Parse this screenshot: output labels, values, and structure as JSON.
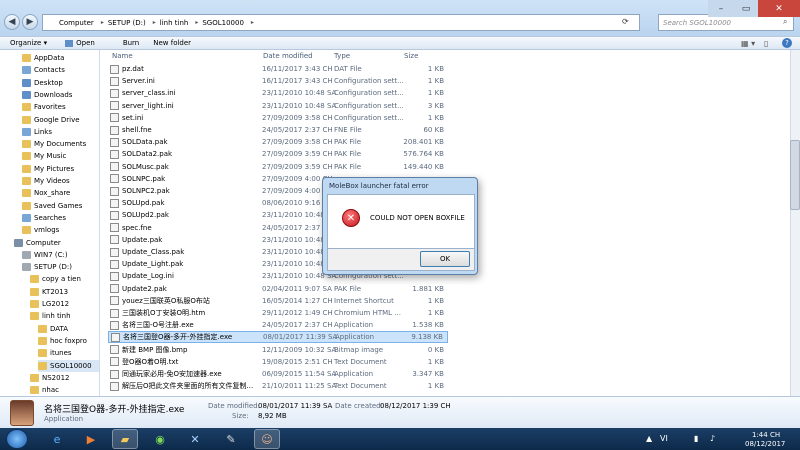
{
  "address": {
    "crumbs": [
      "Computer",
      "SETUP (D:)",
      "linh tinh",
      "SGOL10000"
    ],
    "search_placeholder": "Search SGOL10000"
  },
  "toolbar": {
    "organize": "Organize ▾",
    "open": "Open",
    "burn": "Burn",
    "new_folder": "New folder"
  },
  "nav": [
    {
      "label": "AppData",
      "color": "#e8c15a"
    },
    {
      "label": "Contacts",
      "color": "#7aa6d6"
    },
    {
      "label": "Desktop",
      "color": "#5f8fc9"
    },
    {
      "label": "Downloads",
      "color": "#5f8fc9"
    },
    {
      "label": "Favorites",
      "color": "#e8c15a"
    },
    {
      "label": "Google Drive",
      "color": "#e8c15a"
    },
    {
      "label": "Links",
      "color": "#7aa6d6"
    },
    {
      "label": "My Documents",
      "color": "#e8c15a"
    },
    {
      "label": "My Music",
      "color": "#e8c15a"
    },
    {
      "label": "My Pictures",
      "color": "#e8c15a"
    },
    {
      "label": "My Videos",
      "color": "#e8c15a"
    },
    {
      "label": "Nox_share",
      "color": "#e8c15a"
    },
    {
      "label": "Saved Games",
      "color": "#e8c15a"
    },
    {
      "label": "Searches",
      "color": "#7aa6d6"
    },
    {
      "label": "vmlogs",
      "color": "#e8c15a"
    },
    {
      "label": "Computer",
      "color": "#7a8ea8"
    },
    {
      "label": "WIN7 (C:)",
      "color": "#a0a8b2"
    },
    {
      "label": "SETUP (D:)",
      "color": "#a0a8b2"
    },
    {
      "label": "copy a tien",
      "color": "#e8c15a"
    },
    {
      "label": "KT2013",
      "color": "#e8c15a"
    },
    {
      "label": "LG2012",
      "color": "#e8c15a"
    },
    {
      "label": "linh tinh",
      "color": "#e8c15a"
    },
    {
      "label": "DATA",
      "color": "#e8c15a"
    },
    {
      "label": "hoc foxpro",
      "color": "#e8c15a"
    },
    {
      "label": "itunes",
      "color": "#e8c15a"
    },
    {
      "label": "SGOL10000",
      "color": "#e8c15a"
    },
    {
      "label": "NS2012",
      "color": "#e8c15a"
    },
    {
      "label": "nhac",
      "color": "#e8c15a"
    }
  ],
  "columns": {
    "name": "Name",
    "date": "Date modified",
    "type": "Type",
    "size": "Size"
  },
  "files": [
    {
      "name": "pz.dat",
      "date": "16/11/2017 3:43 CH",
      "type": "DAT File",
      "size": "1 KB"
    },
    {
      "name": "Server.ini",
      "date": "16/11/2017 3:43 CH",
      "type": "Configuration sett...",
      "size": "1 KB"
    },
    {
      "name": "server_class.ini",
      "date": "23/11/2010 10:48 SA",
      "type": "Configuration sett...",
      "size": "1 KB"
    },
    {
      "name": "server_light.ini",
      "date": "23/11/2010 10:48 SA",
      "type": "Configuration sett...",
      "size": "3 KB"
    },
    {
      "name": "set.ini",
      "date": "27/09/2009 3:58 CH",
      "type": "Configuration sett...",
      "size": "1 KB"
    },
    {
      "name": "shell.fne",
      "date": "24/05/2017 2:37 CH",
      "type": "FNE File",
      "size": "60 KB"
    },
    {
      "name": "SOLData.pak",
      "date": "27/09/2009 3:58 CH",
      "type": "PAK File",
      "size": "208.401 KB"
    },
    {
      "name": "SOLData2.pak",
      "date": "27/09/2009 3:59 CH",
      "type": "PAK File",
      "size": "576.764 KB"
    },
    {
      "name": "SOLMusc.pak",
      "date": "27/09/2009 3:59 CH",
      "type": "PAK File",
      "size": "149.440 KB"
    },
    {
      "name": "SOLNPC.pak",
      "date": "27/09/2009 4:00 CH",
      "type": "",
      "size": ""
    },
    {
      "name": "SOLNPC2.pak",
      "date": "27/09/2009 4:00 CH",
      "type": "",
      "size": ""
    },
    {
      "name": "SOLUpd.pak",
      "date": "08/06/2010 9:16 SA",
      "type": "",
      "size": ""
    },
    {
      "name": "SOLUpd2.pak",
      "date": "23/11/2010 10:48 SA",
      "type": "",
      "size": ""
    },
    {
      "name": "spec.fne",
      "date": "24/05/2017 2:37 CH",
      "type": "",
      "size": ""
    },
    {
      "name": "Update.pak",
      "date": "23/11/2010 10:48 SA",
      "type": "",
      "size": ""
    },
    {
      "name": "Update_Class.pak",
      "date": "23/11/2010 10:48 SA",
      "type": "",
      "size": ""
    },
    {
      "name": "Update_Light.pak",
      "date": "23/11/2010 10:48 SA",
      "type": "",
      "size": ""
    },
    {
      "name": "Update_Log.ini",
      "date": "23/11/2010 10:48 SA",
      "type": "Configuration sett...",
      "size": ""
    },
    {
      "name": "Update2.pak",
      "date": "02/04/2011 9:07 SA",
      "type": "PAK File",
      "size": "1.881 KB"
    },
    {
      "name": "youez三国联英O私服O布站",
      "date": "16/05/2014 1:27 CH",
      "type": "Internet Shortcut",
      "size": "1 KB"
    },
    {
      "name": "三国装机O丁安装O明.htm",
      "date": "29/11/2012 1:49 CH",
      "type": "Chromium HTML ...",
      "size": "1 KB"
    },
    {
      "name": "名将三国-O号注册.exe",
      "date": "24/05/2017 2:37 CH",
      "type": "Application",
      "size": "1.538 KB"
    },
    {
      "name": "名将三国登O器-多开-外挂指定.exe",
      "date": "08/01/2017 11:39 SA",
      "type": "Application",
      "size": "9.138 KB"
    },
    {
      "name": "新建 BMP 图像.bmp",
      "date": "12/11/2009 10:32 SA",
      "type": "Bitmap image",
      "size": "0 KB"
    },
    {
      "name": "登O器O着O明.txt",
      "date": "19/08/2015 2:51 CH",
      "type": "Text Document",
      "size": "1 KB"
    },
    {
      "name": "同通玩家必用-免O安加速器.exe",
      "date": "06/09/2015 11:54 SA",
      "type": "Application",
      "size": "3.347 KB"
    },
    {
      "name": "解压后O把此文件夹里面的所有文件复制...",
      "date": "21/10/2011 11:25 SA",
      "type": "Text Document",
      "size": "1 KB"
    }
  ],
  "selected_index": 22,
  "details": {
    "name": "名将三国登O器-多开-外挂指定.exe",
    "type": "Application",
    "modified_label": "Date modified:",
    "modified": "08/01/2017 11:39 SA",
    "created_label": "Date created:",
    "created": "08/12/2017 1:39 CH",
    "size_label": "Size:",
    "size": "8,92 MB"
  },
  "dialog": {
    "title": "MoleBox launcher fatal error",
    "message": "COULD NOT OPEN BOXFILE",
    "ok": "OK"
  },
  "clock": {
    "time": "1:44 CH",
    "date": "08/12/2017"
  },
  "tray": {
    "lang": "VI"
  }
}
